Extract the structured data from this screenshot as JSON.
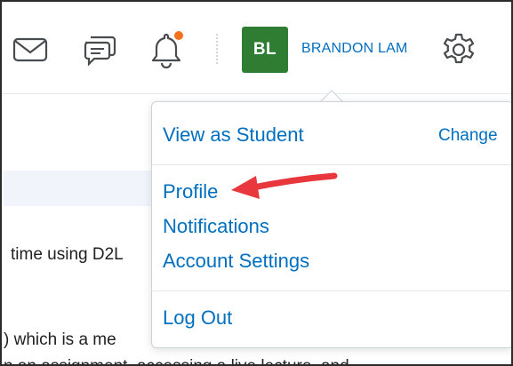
{
  "header": {
    "icons": [
      "mail-icon",
      "chat-icon",
      "bell-icon",
      "gear-icon"
    ],
    "avatar_initials": "BL",
    "user_name": "BRANDON LAM",
    "colors": {
      "avatar": "#2f7d32",
      "link": "#006fbf",
      "notification_dot": "#f2711c"
    }
  },
  "menu": {
    "view_as_student": "View as Student",
    "change": "Change",
    "profile": "Profile",
    "notifications": "Notifications",
    "account_settings": "Account Settings",
    "log_out": "Log Out"
  },
  "background": {
    "line1": "time using D2L",
    "line2": ") which is a me",
    "line3": "n an assignment, accessing a live lecture, and"
  },
  "annotation": {
    "arrow_color": "#e8383d"
  }
}
